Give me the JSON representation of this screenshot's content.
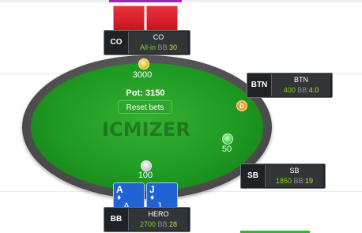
{
  "table": {
    "watermark": "ICMIZER",
    "pot_label": "Pot: 3150",
    "reset_label": "Reset bets",
    "dealer_label": "D",
    "felt_color": "#1f9a22"
  },
  "bets": {
    "co": "3000",
    "sb": "50",
    "bb": "100"
  },
  "seats": {
    "co": {
      "position": "CO",
      "name": "CO",
      "stack": "All-in",
      "bb_label": "BB:",
      "bb_value": "30"
    },
    "btn": {
      "position": "BTN",
      "name": "BTN",
      "stack": "400",
      "bb_label": "BB:",
      "bb_value": "4.0"
    },
    "sb": {
      "position": "SB",
      "name": "SB",
      "stack": "1850",
      "bb_label": "BB:",
      "bb_value": "19"
    },
    "hero": {
      "position": "BB",
      "name": "HERO",
      "stack": "2700",
      "bb_label": "BB:",
      "bb_value": "28"
    }
  },
  "hero_cards": [
    {
      "rank": "A",
      "suit": "♦"
    },
    {
      "rank": "J",
      "suit": "♦"
    }
  ],
  "colors": {
    "card_back": "#c8101c",
    "hero_card": "#2163d3",
    "stack_value": "#7ed321",
    "accent": "#9c27b0"
  }
}
